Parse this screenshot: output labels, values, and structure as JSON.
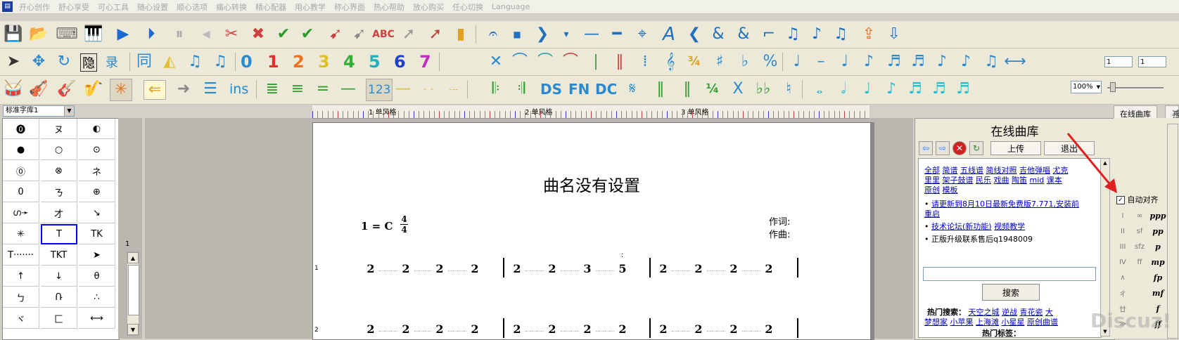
{
  "menu": [
    "开心创作",
    "舒心享受",
    "可心工具",
    "随心设置",
    "顺心选项",
    "痛心转换",
    "精心配器",
    "用心教学",
    "称心界面",
    "热心帮助",
    "放心购买",
    "任心切换",
    "Language"
  ],
  "toolbar_right": {
    "spin1": "1",
    "spin2": "1",
    "zoom": "100%"
  },
  "toolbar_text": {
    "hide": "隐",
    "record": "录",
    "ins": "ins",
    "num123": "123",
    "ds": "DS",
    "fn": "FN",
    "dc": "DC"
  },
  "numbers_row": [
    "0",
    "1",
    "2",
    "3",
    "4",
    "5",
    "6",
    "7"
  ],
  "left_panel": {
    "library_select": "标准字库1",
    "symbols": [
      [
        "⓿",
        "ヌ",
        "◐"
      ],
      [
        "●",
        "○",
        "⊙"
      ],
      [
        "⓪",
        "⊗",
        "ネ"
      ],
      [
        "0",
        "ㄋ",
        "⊕"
      ],
      [
        "ഗ➛",
        "才",
        "↘"
      ],
      [
        "✳",
        "T",
        "TK"
      ],
      [
        "T·······",
        "TKT",
        "➤"
      ],
      [
        "↑",
        "↓",
        "θ"
      ],
      [
        "ㄅ",
        "Ռ",
        "∴"
      ],
      [
        "ヾ",
        "匚",
        "⟷"
      ]
    ],
    "scroll_label": "1"
  },
  "ruler": {
    "labels": [
      "1 单风格",
      "2 单风格",
      "3 单风格"
    ]
  },
  "score": {
    "title": "曲名没有设置",
    "key": "1 = C",
    "meter_top": "4",
    "meter_bottom": "4",
    "lyricist": "作词:",
    "composer": "作曲:",
    "line1_no": "1",
    "line2_no": "2",
    "line1_notes": [
      "2",
      "2",
      "2",
      "2",
      "2",
      "2",
      "3",
      "5",
      "2",
      "2",
      "2",
      "2"
    ],
    "line2_notes": [
      "2",
      "2",
      "2",
      "2",
      "2",
      "2",
      "2",
      "2",
      "2",
      "2",
      "2",
      "2"
    ]
  },
  "online_library": {
    "title": "在线曲库",
    "upload": "上传",
    "exit": "退出",
    "categories_line1": [
      "全部",
      "简谱",
      "五线谱",
      "简线对照",
      "吉他弹唱",
      "尤克"
    ],
    "categories_line2": [
      "里里",
      "架子鼓谱",
      "民乐",
      "戏曲",
      "陶笛",
      "mid",
      "课本"
    ],
    "categories_line3": [
      "原创",
      "模板"
    ],
    "notice1": "请更新到8月10日最新免费版7.771,安装前",
    "notice1_tail": "重启",
    "notice2_a": "技术论坛(新功能)",
    "notice2_b": "视频教学",
    "notice3": "正版升级联系售后q1948009",
    "search_button": "搜索",
    "hot_label": "热门搜索：",
    "hot_line1": [
      "天空之城",
      "逆战",
      "青花瓷",
      "大"
    ],
    "hot_line2": [
      "梦想家",
      "小苹果",
      "上海滩",
      "小星星",
      "原创曲谱"
    ],
    "hot_tags": "热门标签："
  },
  "right_panel": {
    "tab_online": "在线曲库",
    "tab_reduce": "减行",
    "auto_align": "自动对齐",
    "dynamics": [
      "ppp",
      "pp",
      "p",
      "mp",
      "fp",
      "mf",
      "f",
      "ff"
    ],
    "small_marks": [
      "I",
      "II",
      "III",
      "IV",
      "∧",
      "ㄔ",
      "廿",
      "≫",
      "∞",
      "sf",
      "sfz",
      "ff"
    ]
  },
  "watermark": "Discuz!"
}
